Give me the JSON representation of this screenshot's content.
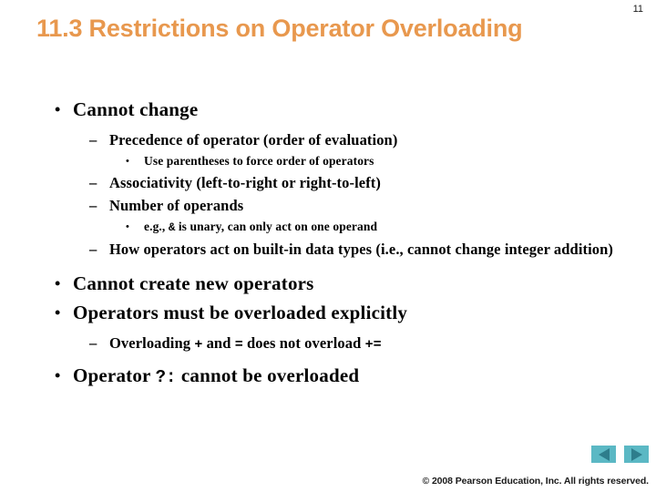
{
  "slide": {
    "page_number": "11",
    "title": "11.3 Restrictions on Operator Overloading",
    "title_color": "#E8984E"
  },
  "content": {
    "bullets": [
      {
        "level": 1,
        "marker": "•",
        "text": "Cannot change"
      },
      {
        "level": 2,
        "marker": "–",
        "text": "Precedence of operator (order of evaluation)"
      },
      {
        "level": 3,
        "marker": "•",
        "text": "Use parentheses to force order of operators"
      },
      {
        "level": 2,
        "marker": "–",
        "text": "Associativity (left-to-right or right-to-left)"
      },
      {
        "level": 2,
        "marker": "–",
        "text": "Number of operands"
      },
      {
        "level": 3,
        "marker": "•",
        "text_before": "e.g., ",
        "code": "&",
        "text_after": " is unary, can only act on one operand"
      },
      {
        "level": 2,
        "marker": "–",
        "text": "How operators act on built-in data types (i.e., cannot change integer addition)"
      },
      {
        "level": 1,
        "marker": "•",
        "text": "Cannot create new operators"
      },
      {
        "level": 1,
        "marker": "•",
        "text": "Operators must be overloaded explicitly"
      },
      {
        "level": 2,
        "marker": "–",
        "text_before": "Overloading ",
        "code": "+",
        "text_mid": " and ",
        "code2": "=",
        "text_mid2": " does not overload ",
        "code3": "+=",
        "text_after": ""
      },
      {
        "level": 1,
        "marker": "•",
        "text_before": "Operator ",
        "code": "?:",
        "text_after": " cannot be overloaded"
      }
    ]
  },
  "footer": {
    "prev_label": "◀",
    "next_label": "▶",
    "copyright": "© 2008 Pearson Education, Inc.  All rights reserved.",
    "button_bg": "#5BB8C4",
    "button_arrow": "#2E7D8C"
  }
}
